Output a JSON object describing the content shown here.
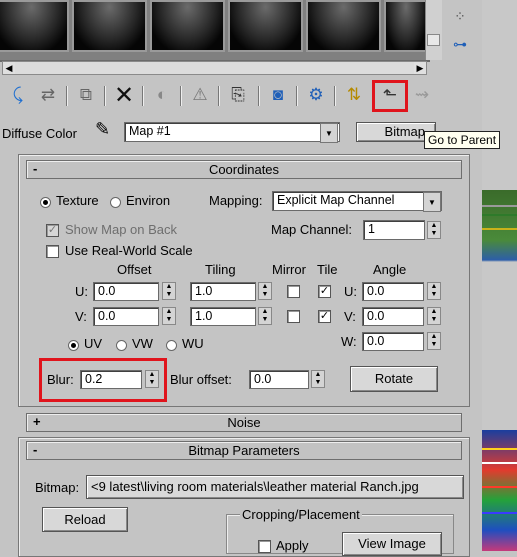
{
  "slots": {
    "count": 5
  },
  "toolbar": {
    "tooltip": "Go to Parent"
  },
  "diffuse": {
    "label": "Diffuse Color",
    "map_name": "Map #1",
    "type_button": "Bitmap"
  },
  "coordinates": {
    "sign": "-",
    "title": "Coordinates",
    "texture_label": "Texture",
    "environ_label": "Environ",
    "mapping_label": "Mapping:",
    "mapping_value": "Explicit Map Channel",
    "show_map_on_back": "Show Map on Back",
    "use_real_world_scale": "Use Real-World Scale",
    "map_channel_label": "Map Channel:",
    "map_channel_value": "1",
    "offset_label": "Offset",
    "tiling_label": "Tiling",
    "mirror_label": "Mirror",
    "tile_label": "Tile",
    "angle_label": "Angle",
    "u_label": "U:",
    "v_label": "V:",
    "w_label": "W:",
    "u_offset": "0.0",
    "v_offset": "0.0",
    "u_tiling": "1.0",
    "v_tiling": "1.0",
    "u_angle": "0.0",
    "v_angle": "0.0",
    "w_angle": "0.0",
    "uv_label": "UV",
    "vw_label": "VW",
    "wu_label": "WU",
    "blur_label": "Blur:",
    "blur_value": "0.2",
    "blur_offset_label": "Blur offset:",
    "blur_offset_value": "0.0",
    "rotate_button": "Rotate"
  },
  "noise": {
    "sign": "+",
    "title": "Noise"
  },
  "bitmap_params": {
    "sign": "-",
    "title": "Bitmap Parameters",
    "bitmap_label": "Bitmap:",
    "bitmap_path": "<9 latest\\living room materials\\leather material Ranch.jpg",
    "reload_button": "Reload",
    "cropping_label": "Cropping/Placement",
    "apply_label": "Apply",
    "view_image_button": "View Image"
  },
  "colors": {
    "highlight": "#e0141c"
  }
}
